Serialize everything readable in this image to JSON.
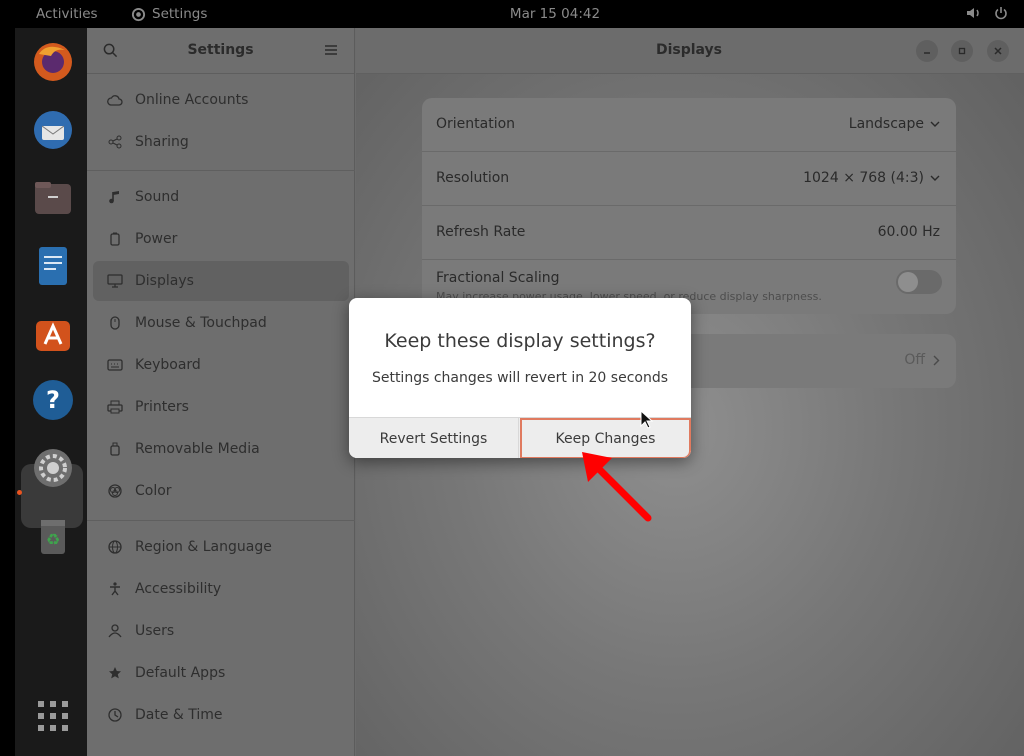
{
  "topbar": {
    "activities": "Activities",
    "app_name": "Settings",
    "clock": "Mar 15  04:42"
  },
  "sidebar": {
    "title": "Settings",
    "items": [
      {
        "label": "Online Accounts"
      },
      {
        "label": "Sharing"
      },
      {
        "label": "Sound"
      },
      {
        "label": "Power"
      },
      {
        "label": "Displays"
      },
      {
        "label": "Mouse & Touchpad"
      },
      {
        "label": "Keyboard"
      },
      {
        "label": "Printers"
      },
      {
        "label": "Removable Media"
      },
      {
        "label": "Color"
      },
      {
        "label": "Region & Language"
      },
      {
        "label": "Accessibility"
      },
      {
        "label": "Users"
      },
      {
        "label": "Default Apps"
      },
      {
        "label": "Date & Time"
      }
    ]
  },
  "main": {
    "title": "Displays",
    "orientation": {
      "label": "Orientation",
      "value": "Landscape"
    },
    "resolution": {
      "label": "Resolution",
      "value": "1024 × 768 (4:3)"
    },
    "refresh": {
      "label": "Refresh Rate",
      "value": "60.00 Hz"
    },
    "fractional": {
      "label": "Fractional Scaling",
      "sub": "May increase power usage, lower speed, or reduce display sharpness."
    },
    "night_light": {
      "value": "Off"
    }
  },
  "dialog": {
    "heading": "Keep these display settings?",
    "message": "Settings changes will revert in 20 seconds",
    "revert_label": "Revert Settings",
    "keep_label": "Keep Changes"
  },
  "colors": {
    "accent": "#e95420",
    "highlight_border": "#e07a5f",
    "arrow": "#ff0000"
  }
}
